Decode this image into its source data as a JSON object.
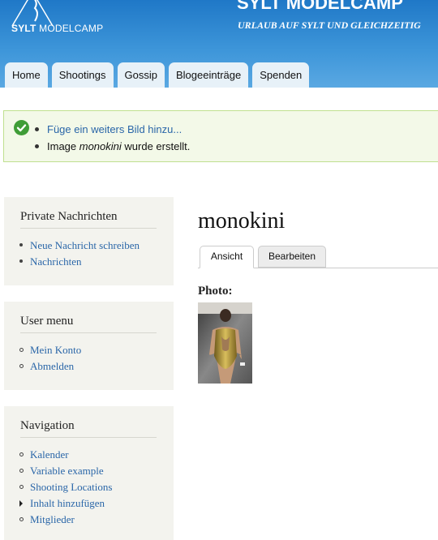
{
  "header": {
    "logo_text_bold": "SYLT",
    "logo_text": "MODELCAMP",
    "site_name": "SYLT MODELCAMP",
    "slogan": "URLAUB AUF SYLT UND GLEICHZEITIG"
  },
  "nav_tabs": [
    "Home",
    "Shootings",
    "Gossip",
    "Blogeeinträge",
    "Spenden"
  ],
  "messages": {
    "link": "Füge ein weiters Bild hinzu...",
    "status_prefix": "Image ",
    "status_name": "monokini",
    "status_suffix": " wurde erstellt."
  },
  "sidebar": {
    "private": {
      "title": "Private Nachrichten",
      "items": [
        "Neue Nachricht schreiben",
        "Nachrichten"
      ]
    },
    "user_menu": {
      "title": "User menu",
      "items": [
        "Mein Konto",
        "Abmelden"
      ]
    },
    "navigation": {
      "title": "Navigation",
      "items": [
        "Kalender",
        "Variable example",
        "Shooting Locations",
        "Inhalt hinzufügen",
        "Mitglieder"
      ]
    }
  },
  "content": {
    "title": "monokini",
    "tabs": [
      "Ansicht",
      "Bearbeiten"
    ],
    "field_label": "Photo:"
  },
  "colors": {
    "header_blue": "#2f86d0",
    "link": "#2a66a8",
    "status_border": "#bfe08f"
  }
}
